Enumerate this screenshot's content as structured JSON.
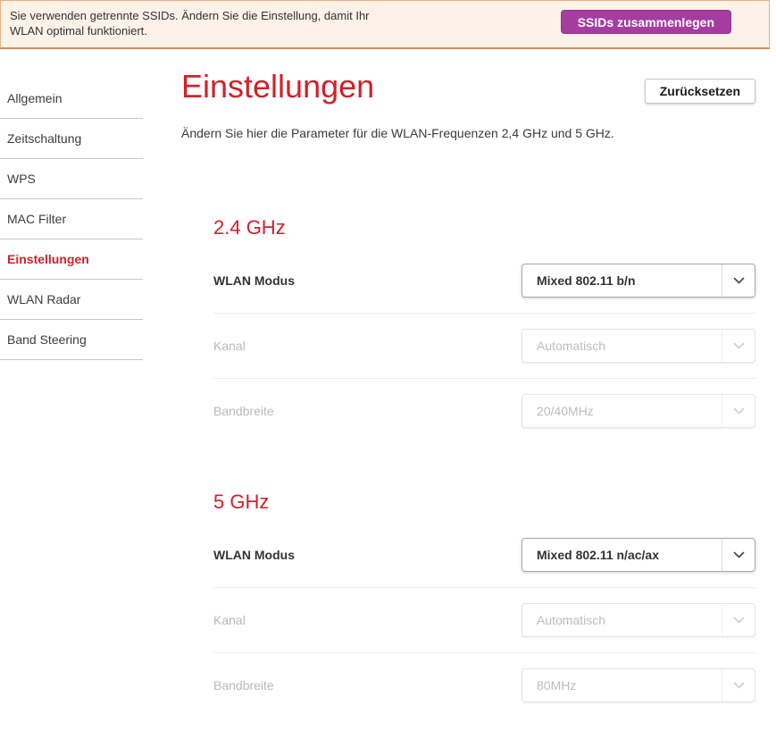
{
  "banner": {
    "message_line1": "Sie verwenden getrennte SSIDs. Ändern Sie die Einstellung, damit Ihr",
    "message_line2": "WLAN optimal funktioniert.",
    "button_label": "SSIDs zusammenlegen",
    "background_color": "#fdf2e8",
    "button_color": "#a53da0"
  },
  "sidebar": {
    "items": [
      {
        "label": "Allgemein",
        "active": false
      },
      {
        "label": "Zeitschaltung",
        "active": false
      },
      {
        "label": "WPS",
        "active": false
      },
      {
        "label": "MAC Filter",
        "active": false
      },
      {
        "label": "Einstellungen",
        "active": true
      },
      {
        "label": "WLAN Radar",
        "active": false
      },
      {
        "label": "Band Steering",
        "active": false
      }
    ]
  },
  "header": {
    "title": "Einstellungen",
    "subtitle": "Ändern Sie hier die Parameter für die WLAN-Frequenzen 2,4 GHz und 5 GHz.",
    "reset_button_label": "Zurücksetzen"
  },
  "sections": [
    {
      "heading": "2.4 GHz",
      "rows": [
        {
          "label": "WLAN Modus",
          "value": "Mixed 802.11 b/n",
          "enabled": true
        },
        {
          "label": "Kanal",
          "value": "Automatisch",
          "enabled": false
        },
        {
          "label": "Bandbreite",
          "value": "20/40MHz",
          "enabled": false
        }
      ]
    },
    {
      "heading": "5 GHz",
      "rows": [
        {
          "label": "WLAN Modus",
          "value": "Mixed 802.11 n/ac/ax",
          "enabled": true
        },
        {
          "label": "Kanal",
          "value": "Automatisch",
          "enabled": false
        },
        {
          "label": "Bandbreite",
          "value": "80MHz",
          "enabled": false
        }
      ]
    }
  ],
  "colors": {
    "accent_red": "#d0212a",
    "accent_purple": "#a53da0",
    "disabled_gray": "#bcbcbc"
  }
}
